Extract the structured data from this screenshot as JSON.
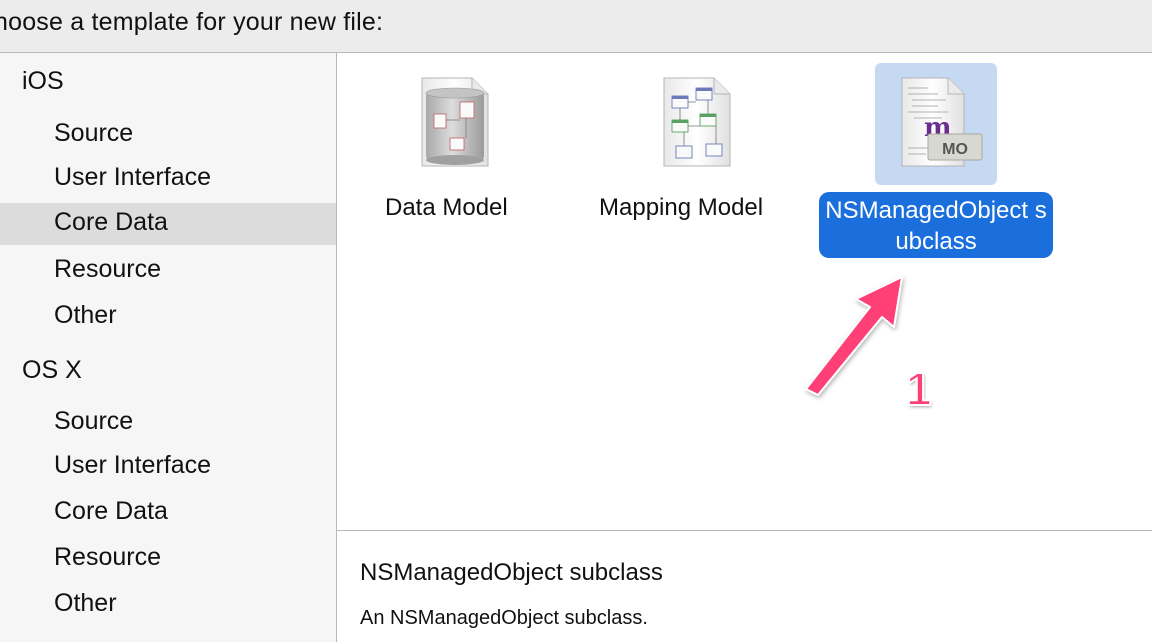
{
  "header": {
    "title": "hoose a template for your new file:"
  },
  "sidebar": {
    "groups": [
      {
        "title": "iOS",
        "items": [
          "Source",
          "User Interface",
          "Core Data",
          "Resource",
          "Other"
        ]
      },
      {
        "title": "OS X",
        "items": [
          "Source",
          "User Interface",
          "Core Data",
          "Resource",
          "Other"
        ]
      }
    ],
    "selected": "iOS / Core Data"
  },
  "templates": [
    {
      "label": "Data Model",
      "icon": "data-model-icon"
    },
    {
      "label": "Mapping Model",
      "icon": "mapping-model-icon"
    },
    {
      "label": "NSManagedObject subclass",
      "icon": "managed-object-icon",
      "icon_text": "m",
      "icon_badge": "MO",
      "selected": true
    }
  ],
  "detail": {
    "title": "NSManagedObject subclass",
    "description": "An NSManagedObject subclass."
  },
  "annotation": {
    "number": "1"
  },
  "colors": {
    "selection_blue": "#1a6fdc",
    "selection_icon_bg": "#c5d9f2",
    "sidebar_selected": "#dcdcdc",
    "annotation_pink": "#ff3f77"
  }
}
